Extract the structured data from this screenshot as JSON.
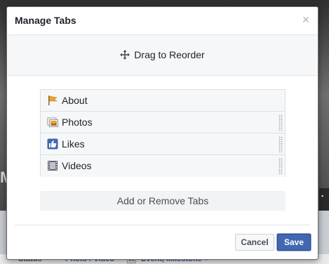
{
  "dialog": {
    "title": "Manage Tabs",
    "close_glyph": "×",
    "reorder_hint": "Drag to Reorder",
    "tabs": [
      {
        "label": "About",
        "icon": "flag-icon"
      },
      {
        "label": "Photos",
        "icon": "photos-icon"
      },
      {
        "label": "Likes",
        "icon": "like-icon"
      },
      {
        "label": "Videos",
        "icon": "film-icon"
      }
    ],
    "add_remove_label": "Add or Remove Tabs",
    "cancel_label": "Cancel",
    "save_label": "Save"
  },
  "background": {
    "left_letter": "M",
    "composer": {
      "status_label": "Status",
      "photo_video_label": "Photo / Video",
      "calendar_number": "31",
      "event_milestone_label": "Event, Milestone +"
    }
  },
  "colors": {
    "primary_button": "#4267b2",
    "row_background": "#f6f7f9",
    "border": "#dddfe2"
  }
}
